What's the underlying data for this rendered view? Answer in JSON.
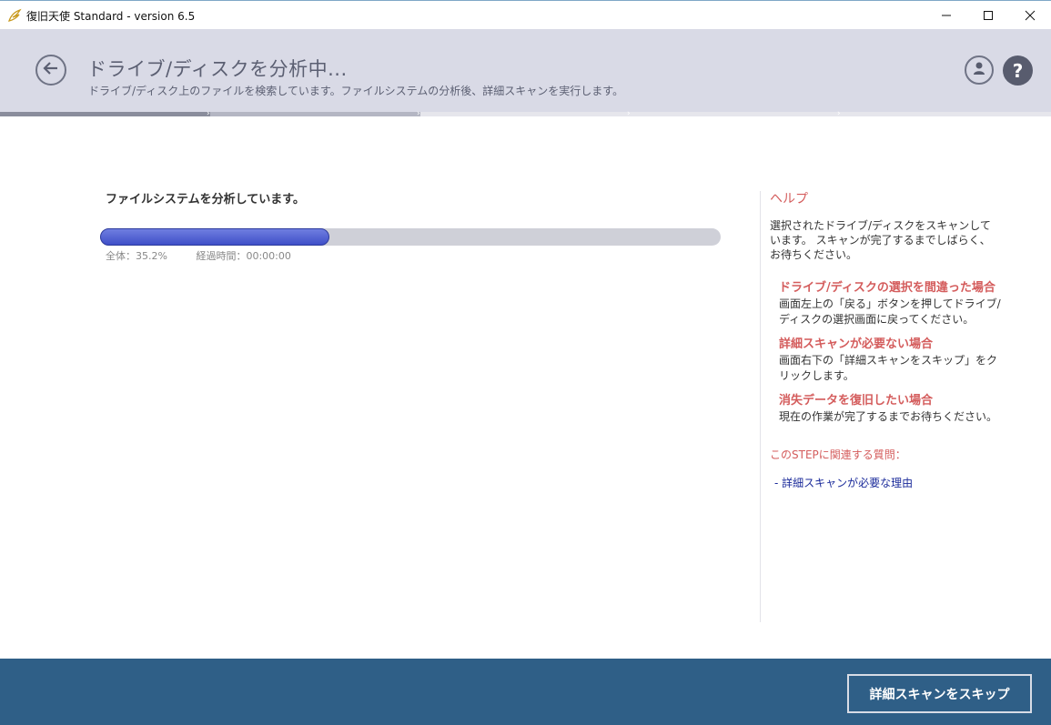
{
  "window": {
    "title": "復旧天使 Standard - version 6.5",
    "icon": "angel-wing-icon"
  },
  "header": {
    "title": "ドライブ/ディスクを分析中...",
    "subtitle": "ドライブ/ディスク上のファイルを検索しています。ファイルシステムの分析後、詳細スキャンを実行します。"
  },
  "steps": {
    "count": 5,
    "completed": 1,
    "current": 2
  },
  "progress": {
    "label": "ファイルシステムを分析しています。",
    "fraction": 0.352,
    "overall_text": "全体：35.2%",
    "elapsed_text": "経過時間：00:00:00"
  },
  "help": {
    "heading": "ヘルプ",
    "intro": "選択されたドライブ/ディスクをスキャンしています。 スキャンが完了するまでしばらく、お待ちください。",
    "items": [
      {
        "title": "ドライブ/ディスクの選択を間違った場合",
        "text": "画面左上の「戻る」ボタンを押してドライブ/ディスクの選択画面に戻ってください。"
      },
      {
        "title": "詳細スキャンが必要ない場合",
        "text": "画面右下の「詳細スキャンをスキップ」をクリックします。"
      },
      {
        "title": "消失データを復旧したい場合",
        "text": "現在の作業が完了するまでお待ちください。"
      }
    ],
    "related_heading": "このSTEPに関連する質問：",
    "related_link": "- 詳細スキャンが必要な理由"
  },
  "footer": {
    "skip_label": "詳細スキャンをスキップ"
  },
  "colors": {
    "header_bg": "#d9dae6",
    "accent_red": "#d45c5c",
    "footer_bg": "#2f5f87",
    "progress_fill": "#4a5ad0"
  }
}
